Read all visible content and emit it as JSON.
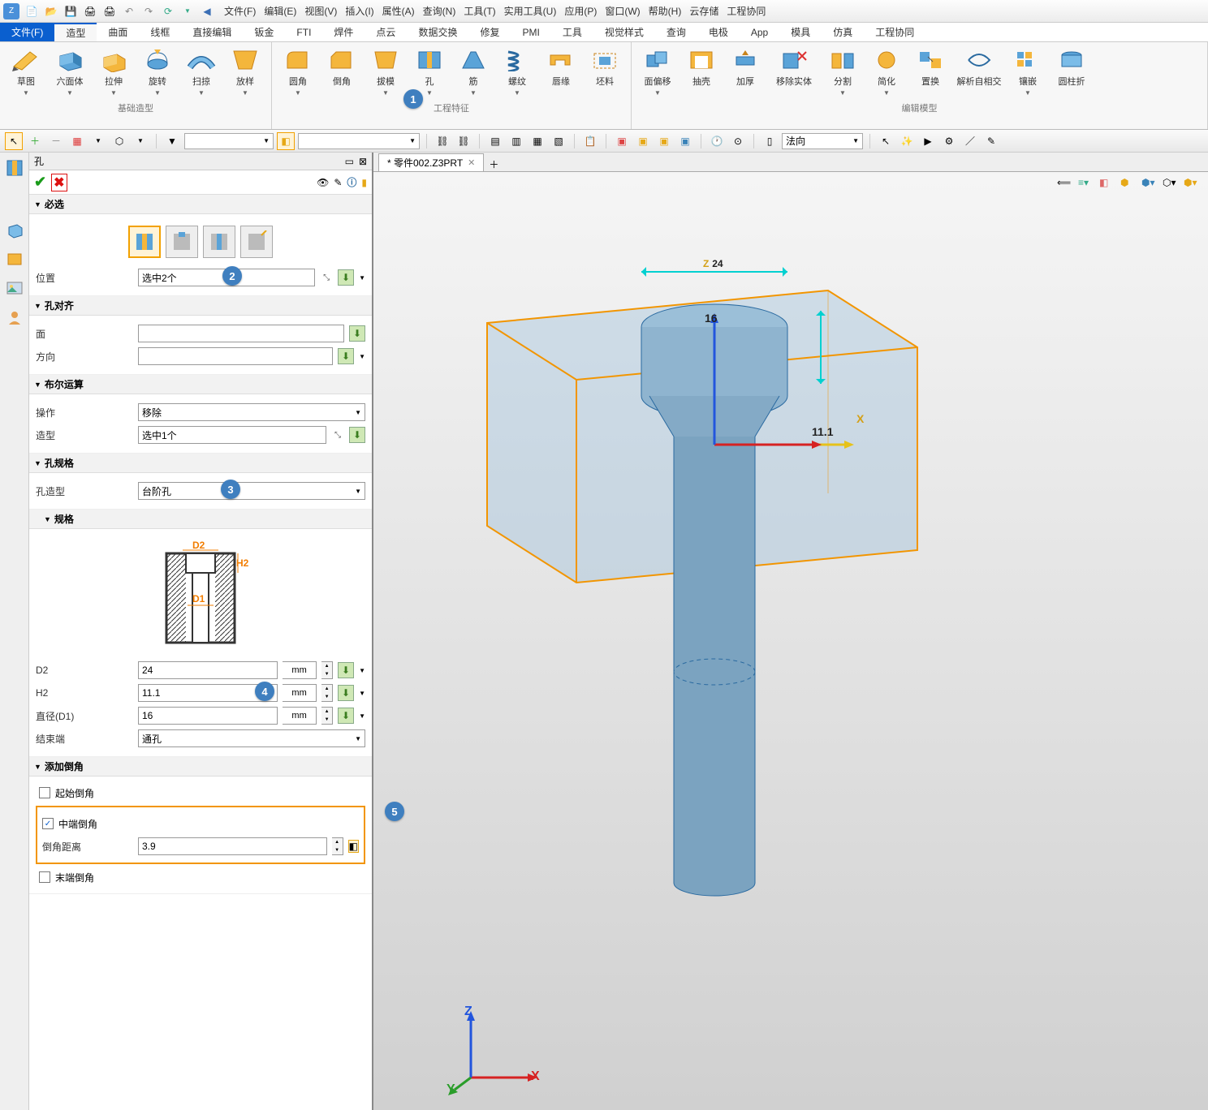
{
  "menus": [
    "文件(F)",
    "编辑(E)",
    "视图(V)",
    "插入(I)",
    "属性(A)",
    "查询(N)",
    "工具(T)",
    "实用工具(U)",
    "应用(P)",
    "窗口(W)",
    "帮助(H)",
    "云存储",
    "工程协同"
  ],
  "ribbon_tabs": {
    "file": "文件(F)",
    "items": [
      "造型",
      "曲面",
      "线框",
      "直接编辑",
      "钣金",
      "FTI",
      "焊件",
      "点云",
      "数据交换",
      "修复",
      "PMI",
      "工具",
      "视觉样式",
      "查询",
      "电极",
      "App",
      "模具",
      "仿真",
      "工程协同"
    ],
    "active": "造型"
  },
  "ribbon_groups": {
    "g1": {
      "label": "基础造型",
      "tools": [
        "草图",
        "六面体",
        "拉伸",
        "旋转",
        "扫掠",
        "放样"
      ]
    },
    "g2": {
      "label": "工程特征",
      "tools": [
        "圆角",
        "倒角",
        "拔模",
        "孔",
        "筋",
        "螺纹",
        "唇缘",
        "坯料"
      ]
    },
    "g3": {
      "label": "编辑模型",
      "tools": [
        "面偏移",
        "抽壳",
        "加厚",
        "移除实体",
        "分割",
        "简化",
        "置换",
        "解析自相交",
        "镶嵌",
        "圆柱折"
      ]
    }
  },
  "toolbar2": {
    "combo1": "",
    "combo2": "法向"
  },
  "doc_tab": {
    "title": "* 零件002.Z3PRT"
  },
  "panel": {
    "title": "孔",
    "section_required": "必选",
    "position_label": "位置",
    "position_value": "选中2个",
    "section_align": "孔对齐",
    "align_face": "面",
    "align_dir": "方向",
    "section_bool": "布尔运算",
    "bool_op_label": "操作",
    "bool_op_value": "移除",
    "bool_shape_label": "造型",
    "bool_shape_value": "选中1个",
    "section_spec": "孔规格",
    "holetype_label": "孔造型",
    "holetype_value": "台阶孔",
    "section_size": "规格",
    "d2_label": "D2",
    "d2_value": "24",
    "d2_unit": "mm",
    "h2_label": "H2",
    "h2_value": "11.1",
    "h2_unit": "mm",
    "d1_label": "直径(D1)",
    "d1_value": "16",
    "d1_unit": "mm",
    "end_label": "结束端",
    "end_value": "通孔",
    "section_chamfer": "添加倒角",
    "chamfer_start": "起始倒角",
    "chamfer_mid": "中端倒角",
    "chamfer_dist_label": "倒角距离",
    "chamfer_dist_value": "3.9",
    "chamfer_end": "末端倒角",
    "diagram": {
      "d2": "D2",
      "d1": "D1",
      "h2": "H2"
    }
  },
  "scene_dims": {
    "d2": "24",
    "d1": "16",
    "h2": "11.1",
    "x": "X",
    "z": "Z"
  },
  "triad": {
    "x": "X",
    "y": "Y",
    "z": "Z"
  },
  "badges": {
    "b1": "1",
    "b2": "2",
    "b3": "3",
    "b4": "4",
    "b5": "5"
  }
}
